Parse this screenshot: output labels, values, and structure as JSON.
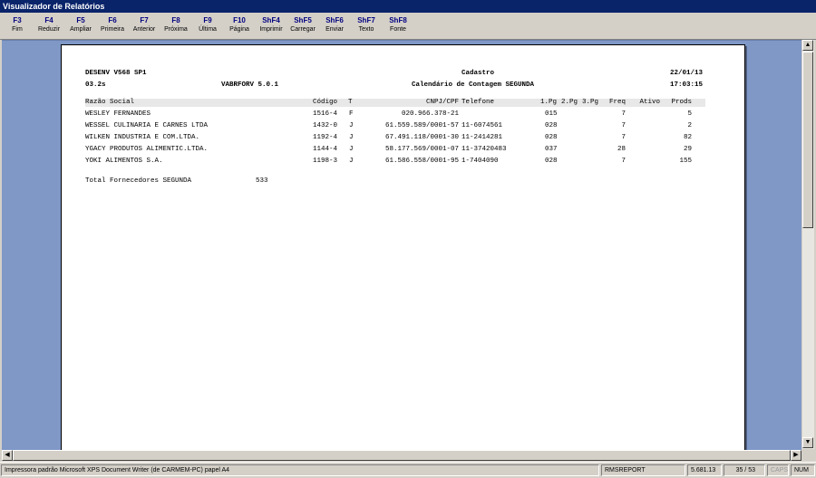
{
  "window": {
    "title": "Visualizador de Relatórios"
  },
  "toolbar": [
    {
      "key": "F3",
      "label": "Fim"
    },
    {
      "key": "F4",
      "label": "Reduzir"
    },
    {
      "key": "F5",
      "label": "Ampliar"
    },
    {
      "key": "F6",
      "label": "Primeira"
    },
    {
      "key": "F7",
      "label": "Anterior"
    },
    {
      "key": "F8",
      "label": "Próxima"
    },
    {
      "key": "F9",
      "label": "Última"
    },
    {
      "key": "F10",
      "label": "Página"
    },
    {
      "key": "ShF4",
      "label": "Imprimir"
    },
    {
      "key": "ShF5",
      "label": "Carregar"
    },
    {
      "key": "ShF6",
      "label": "Enviar"
    },
    {
      "key": "ShF7",
      "label": "Texto"
    },
    {
      "key": "ShF8",
      "label": "Fonte"
    }
  ],
  "report": {
    "header": {
      "left1": "DESENV V568 SP1",
      "center1": "Cadastro",
      "date": "22/01/13",
      "left2": "03.2s",
      "program": "VABRFORV 5.0.1",
      "center2": "Calendário de Contagem SEGUNDA",
      "time": "17:03:15"
    },
    "columns": {
      "razao": "Razão Social",
      "codigo": "Código",
      "t": "T",
      "cnpj": "CNPJ/CPF",
      "telefone": "Telefone",
      "pg1": "1.Pg",
      "pg2": "2.Pg",
      "pg3": "3.Pg",
      "freq": "Freq",
      "ativo": "Ativo",
      "prods": "Prods"
    },
    "rows": [
      {
        "razao": "WESLEY FERNANDES",
        "codigo": "1516-4",
        "t": "F",
        "cnpj": "020.966.378-21",
        "telefone": "",
        "pg1": "015",
        "freq": "7",
        "prods": "5"
      },
      {
        "razao": "WESSEL CULINARIA E CARNES LTDA",
        "codigo": "1432-0",
        "t": "J",
        "cnpj": "61.559.589/0001-57",
        "telefone": "11-6074561",
        "pg1": "028",
        "freq": "7",
        "prods": "2"
      },
      {
        "razao": "WILKEN INDUSTRIA E COM.LTDA.",
        "codigo": "1192-4",
        "t": "J",
        "cnpj": "67.491.118/0001-30",
        "telefone": "11-2414281",
        "pg1": "028",
        "freq": "7",
        "prods": "82"
      },
      {
        "razao": "YGACY PRODUTOS ALIMENTIC.LTDA.",
        "codigo": "1144-4",
        "t": "J",
        "cnpj": "58.177.569/0001-07",
        "telefone": "11-37420483",
        "pg1": "037",
        "freq": "28",
        "prods": "29"
      },
      {
        "razao": "YOKI ALIMENTOS S.A.",
        "codigo": "1198-3",
        "t": "J",
        "cnpj": "61.586.558/0001-95",
        "telefone": "1-7404090",
        "pg1": "028",
        "freq": "7",
        "prods": "155"
      }
    ],
    "total": {
      "label": "Total Fornecedores SEGUNDA",
      "value": "533"
    }
  },
  "statusbar": {
    "printer": "Impressora padrão Microsoft XPS Document Writer (de CARMEM-PC) papel A4",
    "module": "RMSREPORT",
    "version": "5.681.13",
    "pages": "35 / 53",
    "caps": "CAPS",
    "num": "NUM"
  }
}
